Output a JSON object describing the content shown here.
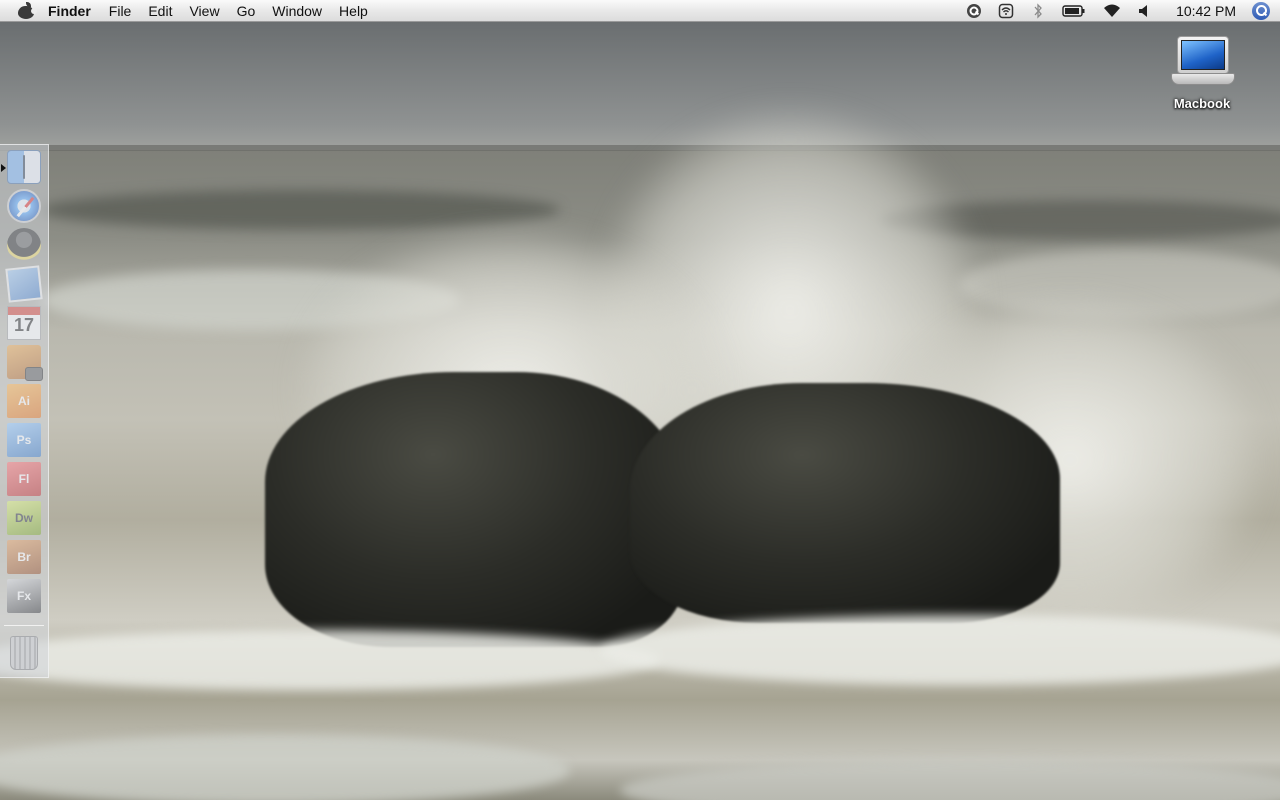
{
  "menubar": {
    "apple_icon": "apple-icon",
    "app_name": "Finder",
    "menus": [
      "File",
      "Edit",
      "View",
      "Go",
      "Window",
      "Help"
    ],
    "status_icons": [
      "quicksilver-icon",
      "airport-base-icon",
      "bluetooth-icon",
      "battery-icon",
      "wifi-icon",
      "volume-icon"
    ],
    "clock": "10:42 PM",
    "spotlight_icon": "spotlight-icon"
  },
  "desktop": {
    "icons": [
      {
        "label": "Macbook",
        "icon": "laptop-icon"
      }
    ]
  },
  "dock": {
    "items": [
      {
        "name": "finder",
        "icon": "finder-icon",
        "running": true
      },
      {
        "name": "safari",
        "icon": "safari-icon"
      },
      {
        "name": "adium",
        "icon": "adium-icon"
      },
      {
        "name": "preview",
        "icon": "preview-icon"
      },
      {
        "name": "ical",
        "icon": "ical-icon",
        "text": "17"
      },
      {
        "name": "iphoto",
        "icon": "iphoto-icon"
      },
      {
        "name": "illustrator",
        "icon": "illustrator-icon",
        "text": "Ai"
      },
      {
        "name": "photoshop",
        "icon": "photoshop-icon",
        "text": "Ps"
      },
      {
        "name": "flash",
        "icon": "flash-icon",
        "text": "Fl"
      },
      {
        "name": "dreamweaver",
        "icon": "dreamweaver-icon",
        "text": "Dw"
      },
      {
        "name": "bridge",
        "icon": "bridge-icon",
        "text": "Br"
      },
      {
        "name": "fireworks",
        "icon": "fx-icon",
        "text": "Fx"
      },
      {
        "name": "trash",
        "icon": "trash-icon"
      }
    ]
  },
  "colors": {
    "menubar_top": "#fafafa",
    "menubar_bottom": "#dcdcdc",
    "desktop_label": "#ffffff"
  }
}
